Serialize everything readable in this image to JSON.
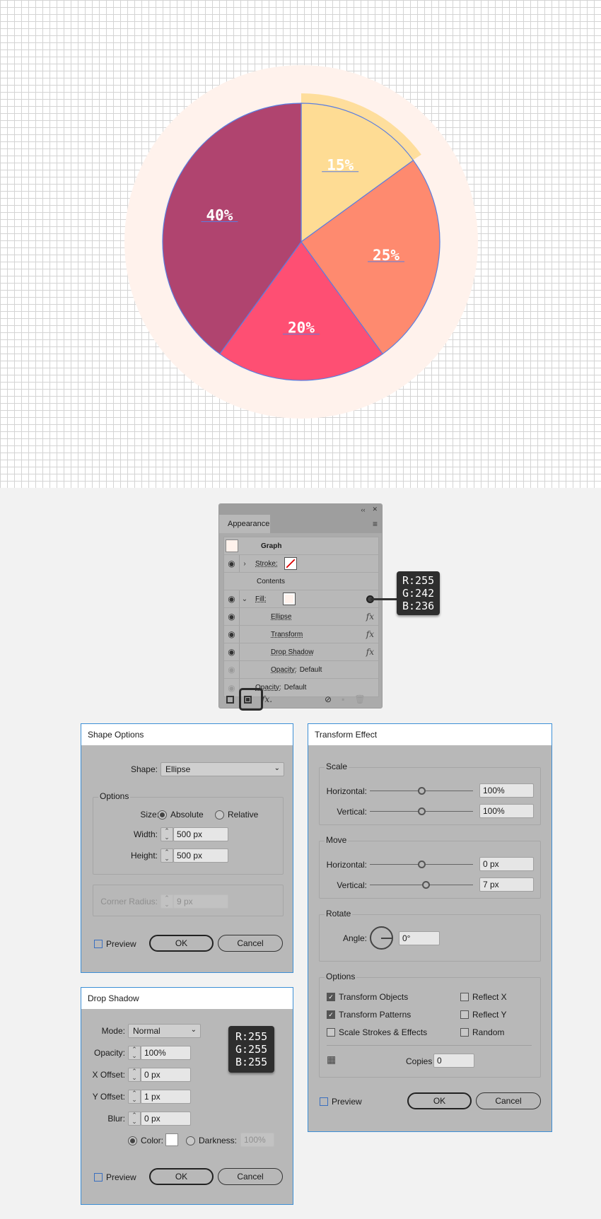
{
  "chart_data": {
    "type": "pie",
    "title": "",
    "slices": [
      {
        "label": "15%",
        "value": 15,
        "color": "#fedc94"
      },
      {
        "label": "25%",
        "value": 25,
        "color": "#fe8a6f"
      },
      {
        "label": "20%",
        "value": 20,
        "color": "#fe4f73"
      },
      {
        "label": "40%",
        "value": 40,
        "color": "#b0446f"
      }
    ],
    "start": "top, clockwise",
    "selected_slice_label": "15%",
    "background_circle_color": "#fff2ec",
    "selection_outline_color": "#5b7ee0"
  },
  "appearance": {
    "tab": "Appearance",
    "collapse_glyph": "‹‹",
    "close_glyph": "✕",
    "menu_glyph": "≡",
    "rows": [
      {
        "label": "Graph"
      },
      {
        "label": "Stroke:"
      },
      {
        "label": "Contents"
      },
      {
        "label": "Fill:"
      },
      {
        "label": "Ellipse",
        "fx": "fx"
      },
      {
        "label": "Transform",
        "fx": "fx"
      },
      {
        "label": "Drop Shadow",
        "fx": "fx"
      },
      {
        "label": "Opacity:",
        "value": "Default"
      },
      {
        "label": "Opacity:",
        "value": "Default"
      }
    ],
    "fill_color_tip": {
      "r": "R:255",
      "g": "G:242",
      "b": "B:236"
    },
    "bottom_fx": "fx."
  },
  "shape_options": {
    "title": "Shape Options",
    "shape_label": "Shape:",
    "shape_value": "Ellipse",
    "options_group": "Options",
    "size_label": "Size:",
    "absolute": "Absolute",
    "relative": "Relative",
    "width_label": "Width:",
    "width_value": "500 px",
    "height_label": "Height:",
    "height_value": "500 px",
    "corner_label": "Corner Radius:",
    "corner_value": "9 px",
    "preview": "Preview",
    "ok": "OK",
    "cancel": "Cancel"
  },
  "drop_shadow": {
    "title": "Drop Shadow",
    "mode_label": "Mode:",
    "mode_value": "Normal",
    "opacity_label": "Opacity:",
    "opacity_value": "100%",
    "x_label": "X Offset:",
    "x_value": "0 px",
    "y_label": "Y Offset:",
    "y_value": "1 px",
    "blur_label": "Blur:",
    "blur_value": "0 px",
    "color_label": "Color:",
    "darkness_label": "Darkness:",
    "darkness_value": "100%",
    "preview": "Preview",
    "ok": "OK",
    "cancel": "Cancel",
    "color_tip": {
      "r": "R:255",
      "g": "G:255",
      "b": "B:255"
    }
  },
  "transform": {
    "title": "Transform Effect",
    "scale_group": "Scale",
    "move_group": "Move",
    "rotate_group": "Rotate",
    "options_group": "Options",
    "horizontal": "Horizontal:",
    "vertical": "Vertical:",
    "scale_h": "100%",
    "scale_v": "100%",
    "move_h": "0 px",
    "move_v": "7 px",
    "angle_label": "Angle:",
    "angle_value": "0°",
    "transform_objects": "Transform Objects",
    "transform_patterns": "Transform Patterns",
    "scale_strokes": "Scale Strokes & Effects",
    "reflect_x": "Reflect X",
    "reflect_y": "Reflect Y",
    "random": "Random",
    "copies_label": "Copies",
    "copies_value": "0",
    "preview": "Preview",
    "ok": "OK",
    "cancel": "Cancel"
  }
}
